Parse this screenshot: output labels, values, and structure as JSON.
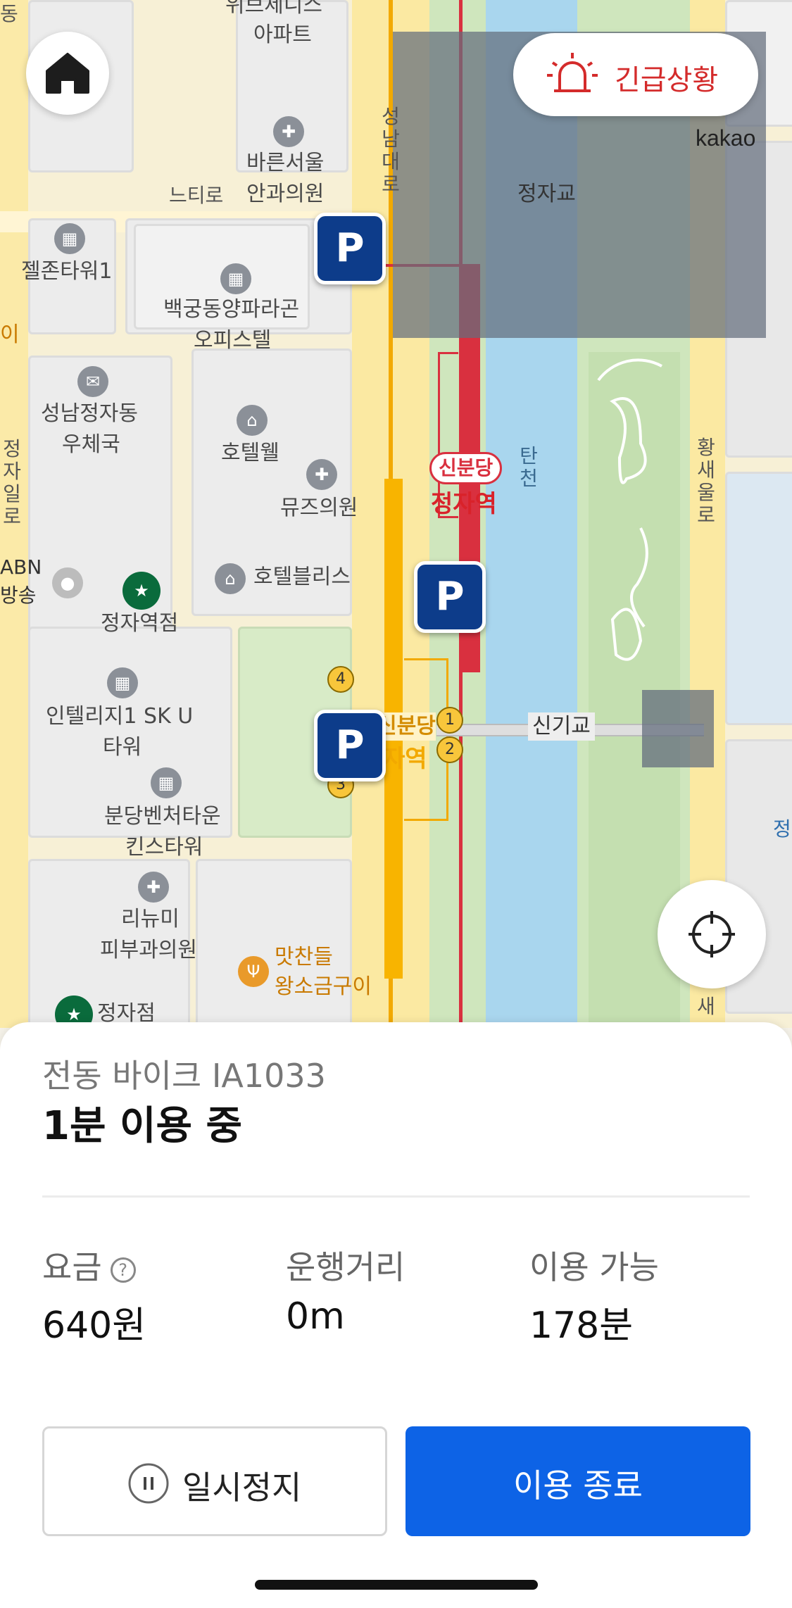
{
  "map": {
    "labels": {
      "apartment_top": "위브제니스",
      "apartment_bottom": "아파트",
      "dong": "동",
      "seongnam_daero": "성남대로",
      "neutiro": "느티로",
      "clinic_top": "바른서울",
      "clinic_bottom": "안과의원",
      "jeongja_bridge": "정자교",
      "jeljon": "젤존타워1",
      "paragon_top": "백궁동양파라곤",
      "paragon_bottom": "오피스텔",
      "ee": "이",
      "post_top": "성남정자동",
      "post_bottom": "우체국",
      "hotel_well": "호텔웰",
      "muz": "뮤즈의원",
      "tancheon": "탄천",
      "hwangsaeul": "황새울로",
      "jeongja_il": "정자일로",
      "abn_top": "ABN",
      "abn_bottom": "방송",
      "hotel_bliss": "호텔블리스",
      "starbucks1": "정자역점",
      "intelligy_top": "인텔리지1 SK U",
      "intelligy_bottom": "타워",
      "venture_top": "분당벤처타운",
      "venture_bottom": "킨스타워",
      "singi_bridge": "신기교",
      "station_line": "신분당",
      "station_name": "정자역",
      "station2_line": "신분당",
      "station2_name": "자역",
      "renew_top": "리뉴미",
      "renew_bottom": "피부과의원",
      "matchan_top": "맛찬들",
      "matchan_bottom": "왕소금구이",
      "starbucks2": "정자점",
      "jeong": "정",
      "sae": "새",
      "kakao": "kakao"
    },
    "parking_label": "P",
    "exits": [
      "1",
      "2",
      "3",
      "4"
    ],
    "home_icon": "home-icon",
    "emergency_icon": "alarm-siren-icon",
    "emergency_label": "긴급상황",
    "locate_icon": "crosshair-icon"
  },
  "sheet": {
    "vehicle": "전동 바이크 IA1033",
    "status": "1분 이용 중",
    "stats": [
      {
        "label": "요금",
        "value": "640원"
      },
      {
        "label": "운행거리",
        "value": "0m"
      },
      {
        "label": "이용 가능",
        "value": "178분"
      }
    ],
    "help_icon": "?",
    "pause_label": "일시정지",
    "end_label": "이용 종료"
  },
  "colors": {
    "primary_blue": "#0d63e6",
    "parking_blue": "#0d3c8a",
    "emergency_red": "#d42b2b",
    "river": "#a9d6ee",
    "park": "#cfe6bd",
    "rail_red": "#d9303f",
    "road_yellow": "#f8b400"
  }
}
